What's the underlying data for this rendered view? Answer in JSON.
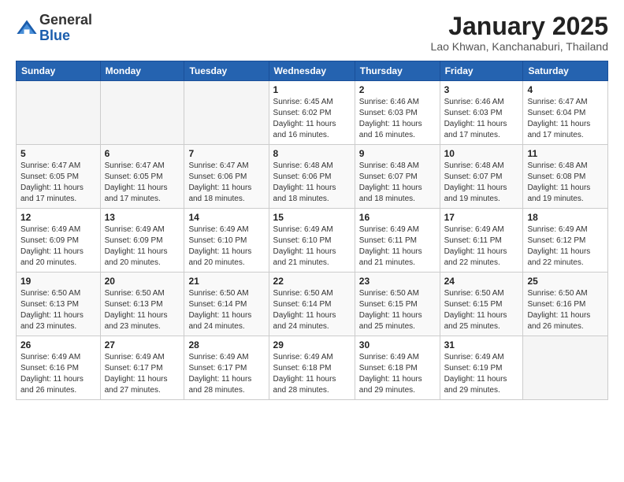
{
  "logo": {
    "general": "General",
    "blue": "Blue"
  },
  "title": "January 2025",
  "location": "Lao Khwan, Kanchanaburi, Thailand",
  "headers": [
    "Sunday",
    "Monday",
    "Tuesday",
    "Wednesday",
    "Thursday",
    "Friday",
    "Saturday"
  ],
  "weeks": [
    [
      {
        "day": "",
        "info": ""
      },
      {
        "day": "",
        "info": ""
      },
      {
        "day": "",
        "info": ""
      },
      {
        "day": "1",
        "info": "Sunrise: 6:45 AM\nSunset: 6:02 PM\nDaylight: 11 hours\nand 16 minutes."
      },
      {
        "day": "2",
        "info": "Sunrise: 6:46 AM\nSunset: 6:03 PM\nDaylight: 11 hours\nand 16 minutes."
      },
      {
        "day": "3",
        "info": "Sunrise: 6:46 AM\nSunset: 6:03 PM\nDaylight: 11 hours\nand 17 minutes."
      },
      {
        "day": "4",
        "info": "Sunrise: 6:47 AM\nSunset: 6:04 PM\nDaylight: 11 hours\nand 17 minutes."
      }
    ],
    [
      {
        "day": "5",
        "info": "Sunrise: 6:47 AM\nSunset: 6:05 PM\nDaylight: 11 hours\nand 17 minutes."
      },
      {
        "day": "6",
        "info": "Sunrise: 6:47 AM\nSunset: 6:05 PM\nDaylight: 11 hours\nand 17 minutes."
      },
      {
        "day": "7",
        "info": "Sunrise: 6:47 AM\nSunset: 6:06 PM\nDaylight: 11 hours\nand 18 minutes."
      },
      {
        "day": "8",
        "info": "Sunrise: 6:48 AM\nSunset: 6:06 PM\nDaylight: 11 hours\nand 18 minutes."
      },
      {
        "day": "9",
        "info": "Sunrise: 6:48 AM\nSunset: 6:07 PM\nDaylight: 11 hours\nand 18 minutes."
      },
      {
        "day": "10",
        "info": "Sunrise: 6:48 AM\nSunset: 6:07 PM\nDaylight: 11 hours\nand 19 minutes."
      },
      {
        "day": "11",
        "info": "Sunrise: 6:48 AM\nSunset: 6:08 PM\nDaylight: 11 hours\nand 19 minutes."
      }
    ],
    [
      {
        "day": "12",
        "info": "Sunrise: 6:49 AM\nSunset: 6:09 PM\nDaylight: 11 hours\nand 20 minutes."
      },
      {
        "day": "13",
        "info": "Sunrise: 6:49 AM\nSunset: 6:09 PM\nDaylight: 11 hours\nand 20 minutes."
      },
      {
        "day": "14",
        "info": "Sunrise: 6:49 AM\nSunset: 6:10 PM\nDaylight: 11 hours\nand 20 minutes."
      },
      {
        "day": "15",
        "info": "Sunrise: 6:49 AM\nSunset: 6:10 PM\nDaylight: 11 hours\nand 21 minutes."
      },
      {
        "day": "16",
        "info": "Sunrise: 6:49 AM\nSunset: 6:11 PM\nDaylight: 11 hours\nand 21 minutes."
      },
      {
        "day": "17",
        "info": "Sunrise: 6:49 AM\nSunset: 6:11 PM\nDaylight: 11 hours\nand 22 minutes."
      },
      {
        "day": "18",
        "info": "Sunrise: 6:49 AM\nSunset: 6:12 PM\nDaylight: 11 hours\nand 22 minutes."
      }
    ],
    [
      {
        "day": "19",
        "info": "Sunrise: 6:50 AM\nSunset: 6:13 PM\nDaylight: 11 hours\nand 23 minutes."
      },
      {
        "day": "20",
        "info": "Sunrise: 6:50 AM\nSunset: 6:13 PM\nDaylight: 11 hours\nand 23 minutes."
      },
      {
        "day": "21",
        "info": "Sunrise: 6:50 AM\nSunset: 6:14 PM\nDaylight: 11 hours\nand 24 minutes."
      },
      {
        "day": "22",
        "info": "Sunrise: 6:50 AM\nSunset: 6:14 PM\nDaylight: 11 hours\nand 24 minutes."
      },
      {
        "day": "23",
        "info": "Sunrise: 6:50 AM\nSunset: 6:15 PM\nDaylight: 11 hours\nand 25 minutes."
      },
      {
        "day": "24",
        "info": "Sunrise: 6:50 AM\nSunset: 6:15 PM\nDaylight: 11 hours\nand 25 minutes."
      },
      {
        "day": "25",
        "info": "Sunrise: 6:50 AM\nSunset: 6:16 PM\nDaylight: 11 hours\nand 26 minutes."
      }
    ],
    [
      {
        "day": "26",
        "info": "Sunrise: 6:49 AM\nSunset: 6:16 PM\nDaylight: 11 hours\nand 26 minutes."
      },
      {
        "day": "27",
        "info": "Sunrise: 6:49 AM\nSunset: 6:17 PM\nDaylight: 11 hours\nand 27 minutes."
      },
      {
        "day": "28",
        "info": "Sunrise: 6:49 AM\nSunset: 6:17 PM\nDaylight: 11 hours\nand 28 minutes."
      },
      {
        "day": "29",
        "info": "Sunrise: 6:49 AM\nSunset: 6:18 PM\nDaylight: 11 hours\nand 28 minutes."
      },
      {
        "day": "30",
        "info": "Sunrise: 6:49 AM\nSunset: 6:18 PM\nDaylight: 11 hours\nand 29 minutes."
      },
      {
        "day": "31",
        "info": "Sunrise: 6:49 AM\nSunset: 6:19 PM\nDaylight: 11 hours\nand 29 minutes."
      },
      {
        "day": "",
        "info": ""
      }
    ]
  ]
}
